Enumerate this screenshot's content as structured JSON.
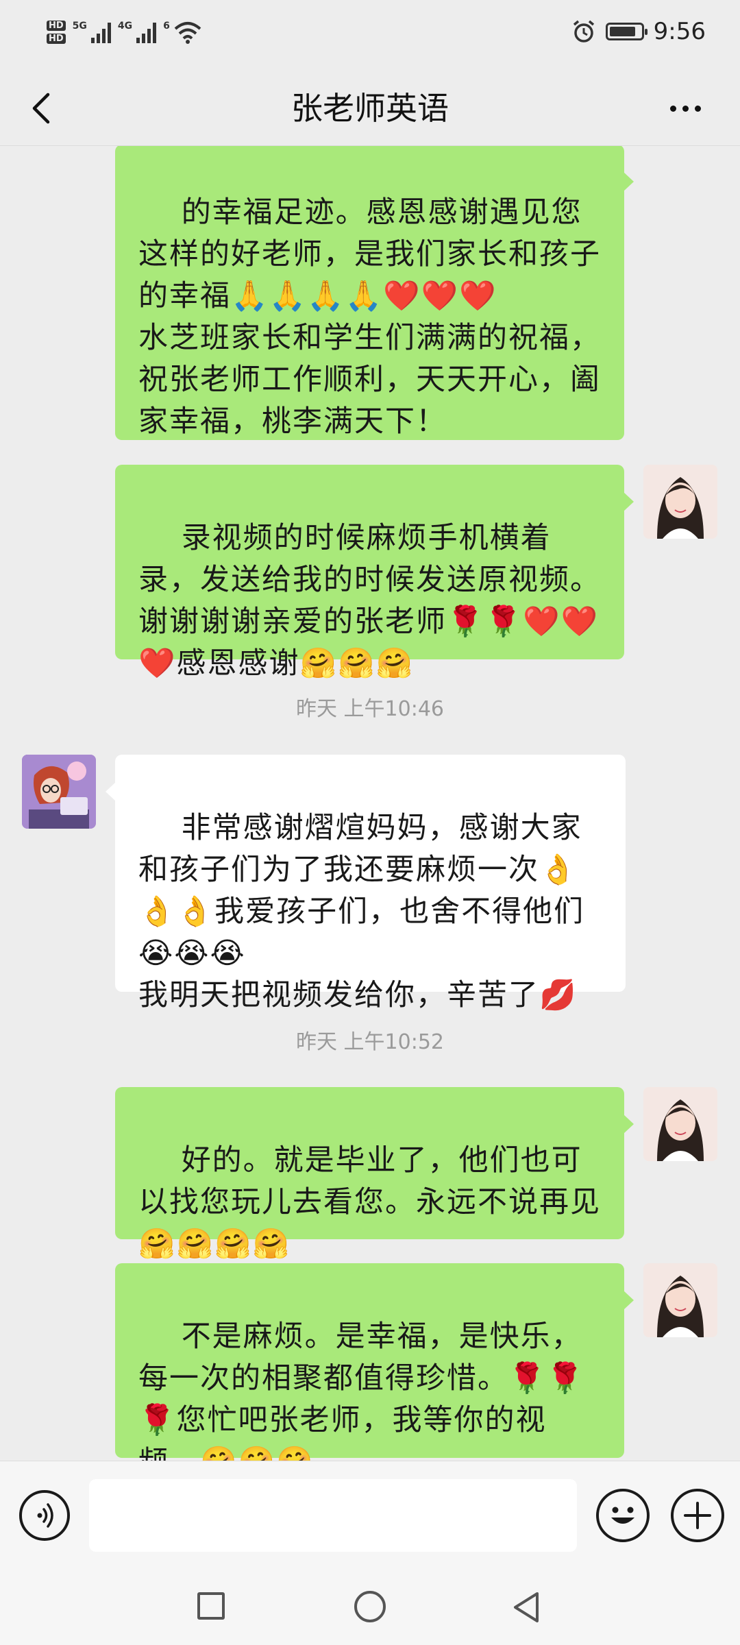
{
  "status_bar": {
    "hd_badges": [
      "HD",
      "HD"
    ],
    "network_1": "5G",
    "network_2": "4G",
    "wifi_badge": "6",
    "time": "9:56",
    "battery_level": 0.85,
    "icons": [
      "hd-icon",
      "signal-icon",
      "wifi-icon",
      "alarm-icon",
      "battery-icon"
    ]
  },
  "header": {
    "title": "张老师英语",
    "back_icon": "chevron-left-icon",
    "more_icon": "more-dots-icon"
  },
  "messages": [
    {
      "sender": "me",
      "text": "的幸福足迹。感恩感谢遇见您这样的好老师，是我们家长和孩子的幸福🙏🙏🙏🙏❤️❤️❤️\n水芝班家长和学生们满满的祝福，祝张老师工作顺利，天天开心，阖家幸福，桃李满天下！"
    },
    {
      "sender": "me",
      "text": "录视频的时候麻烦手机横着录，发送给我的时候发送原视频。谢谢谢谢亲爱的张老师🌹🌹❤️❤️❤️感恩感谢🤗🤗🤗"
    },
    {
      "type": "time",
      "text": "昨天 上午10:46"
    },
    {
      "sender": "teacher",
      "text": "非常感谢熠煊妈妈，感谢大家和孩子们为了我还要麻烦一次👌👌👌我爱孩子们，也舍不得他们😭😭😭\n我明天把视频发给你，辛苦了💋"
    },
    {
      "type": "time",
      "text": "昨天 上午10:52"
    },
    {
      "sender": "me",
      "text": "好的。就是毕业了，他们也可以找您玩儿去看您。永远不说再见🤗🤗🤗🤗"
    },
    {
      "sender": "me",
      "text": "不是麻烦。是幸福，是快乐，每一次的相聚都值得珍惜。🌹🌹🌹您忙吧张老师，我等你的视频。🤗🤗🤗"
    }
  ],
  "input_bar": {
    "voice_icon": "voice-icon",
    "text_value": "",
    "emoji_icon": "emoji-icon",
    "plus_icon": "plus-icon"
  },
  "nav_bar": {
    "icons": [
      "recent-apps-icon",
      "home-icon",
      "back-triangle-icon"
    ]
  },
  "colors": {
    "background": "#ededed",
    "my_bubble": "#a9e97a",
    "their_bubble": "#ffffff",
    "timestamp": "#9a9a9a"
  }
}
